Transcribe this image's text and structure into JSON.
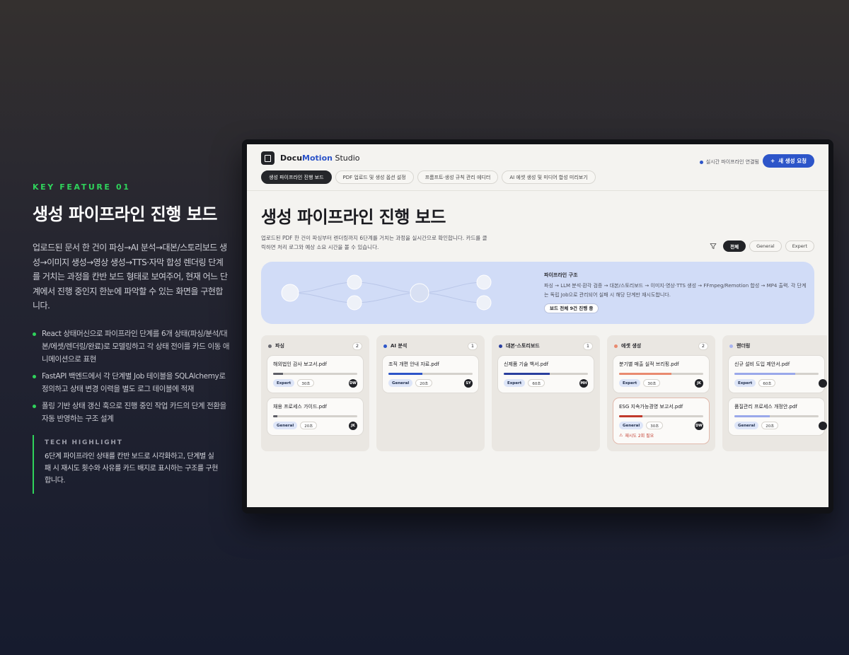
{
  "feature": {
    "eyebrow": "KEY FEATURE 01",
    "title": "생성 파이프라인 진행 보드",
    "description": "업로드된 문서 한 건이 파싱→AI 분석→대본/스토리보드 생성→이미지 생성→영상 생성→TTS·자막 합성 렌더링 단계를 거치는 과정을 칸반 보드 형태로 보여주어, 현재 어느 단계에서 진행 중인지 한눈에 파악할 수 있는 화면을 구현합니다.",
    "bullets": [
      "React 상태머신으로 파이프라인 단계를 6개 상태(파싱/분석/대본/에셋/렌더링/완료)로 모델링하고 각 상태 전이를 카드 이동 애니메이션으로 표현",
      "FastAPI 백엔드에서 각 단계별 Job 테이블을 SQLAlchemy로 정의하고 상태 변경 이력을 별도 로그 테이블에 적재",
      "폴링 기반 상태 갱신 훅으로 진행 중인 작업 카드의 단계 전환을 자동 반영하는 구조 설계"
    ],
    "tech_title": "TECH HIGHLIGHT",
    "tech_text": "6단계 파이프라인 상태를 칸반 보드로 시각화하고, 단계별 실패 시 재시도 횟수와 사유를 카드 배지로 표시하는 구조를 구현합니다."
  },
  "app": {
    "brand_part1": "Docu",
    "brand_part2": "Motion",
    "brand_part3": " Studio",
    "connection_status": "실시간 파이프라인 연결됨",
    "new_request_label": "새 생성 요청",
    "tabs": [
      {
        "label": "생성 파이프라인 진행 보드",
        "active": true
      },
      {
        "label": "PDF 업로드 및 생성 옵션 설정"
      },
      {
        "label": "프롬프트·생성 규칙 관리 에디터"
      },
      {
        "label": "AI 에셋 생성 및 미디어 합성 미리보기"
      }
    ],
    "page_title": "생성 파이프라인 진행 보드",
    "page_desc": "업로드된 PDF 한 건이 파싱부터 렌더링까지 6단계를 거치는 과정을 실시간으로 확인합니다. 카드를 클릭하면 처리 로그와 예상 소요 시간을 볼 수 있습니다.",
    "filters": [
      "전체",
      "General",
      "Expert"
    ],
    "banner": {
      "title": "파이프라인 구조",
      "desc": "파싱 → LLM 분석·환각 검증 → 대본/스토리보드 → 이미지·영상·TTS 생성 → FFmpeg/Remotion 합성 → MP4 출력. 각 단계는 독립 Job으로 관리되어 실패 시 해당 단계만 재시도합니다.",
      "badge": "보드 전체 9건 진행 중"
    },
    "columns": [
      {
        "title": "파싱",
        "count": "2",
        "color": "#6b6b72",
        "cards": [
          {
            "title": "해외법인 감사 보고서.pdf",
            "level": "Expert",
            "duration": "30초",
            "owner": "DW",
            "progress": 0.12,
            "bar": "#5e5e66"
          },
          {
            "title": "채용 프로세스 가이드.pdf",
            "level": "General",
            "duration": "20초",
            "owner": "JK",
            "progress": 0.05,
            "bar": "#5e5e66"
          }
        ]
      },
      {
        "title": "AI 분석",
        "count": "1",
        "color": "#2d55c9",
        "cards": [
          {
            "title": "조직 개편 안내 자료.pdf",
            "level": "General",
            "duration": "20초",
            "owner": "SY",
            "progress": 0.4,
            "bar": "#2d55c9"
          }
        ]
      },
      {
        "title": "대본·스토리보드",
        "count": "1",
        "color": "#2a3f9e",
        "cards": [
          {
            "title": "신제품 기술 백서.pdf",
            "level": "Expert",
            "duration": "60초",
            "owner": "MH",
            "progress": 0.55,
            "bar": "#2a3f9e"
          }
        ]
      },
      {
        "title": "에셋 생성",
        "count": "2",
        "color": "#e98a6f",
        "cards": [
          {
            "title": "분기별 매출 실적 브리핑.pdf",
            "level": "Expert",
            "duration": "30초",
            "owner": "JK",
            "progress": 0.62,
            "bar": "#e98a6f"
          },
          {
            "title": "ESG 지속가능경영 보고서.pdf",
            "level": "General",
            "duration": "30초",
            "owner": "DW",
            "progress": 0.28,
            "bar": "#c0392b",
            "warning": "재시도 2회 필요"
          }
        ]
      },
      {
        "title": "렌더링",
        "count": "",
        "color": "#a9b4f0",
        "cards": [
          {
            "title": "신규 설비 도입 제안서.pdf",
            "level": "Expert",
            "duration": "60초",
            "owner": "",
            "progress": 0.72,
            "bar": "#9aa8ea"
          },
          {
            "title": "품질관리 프로세스 개정안.pdf",
            "level": "General",
            "duration": "20초",
            "owner": "",
            "progress": 0.42,
            "bar": "#9aa8ea"
          }
        ]
      }
    ]
  }
}
